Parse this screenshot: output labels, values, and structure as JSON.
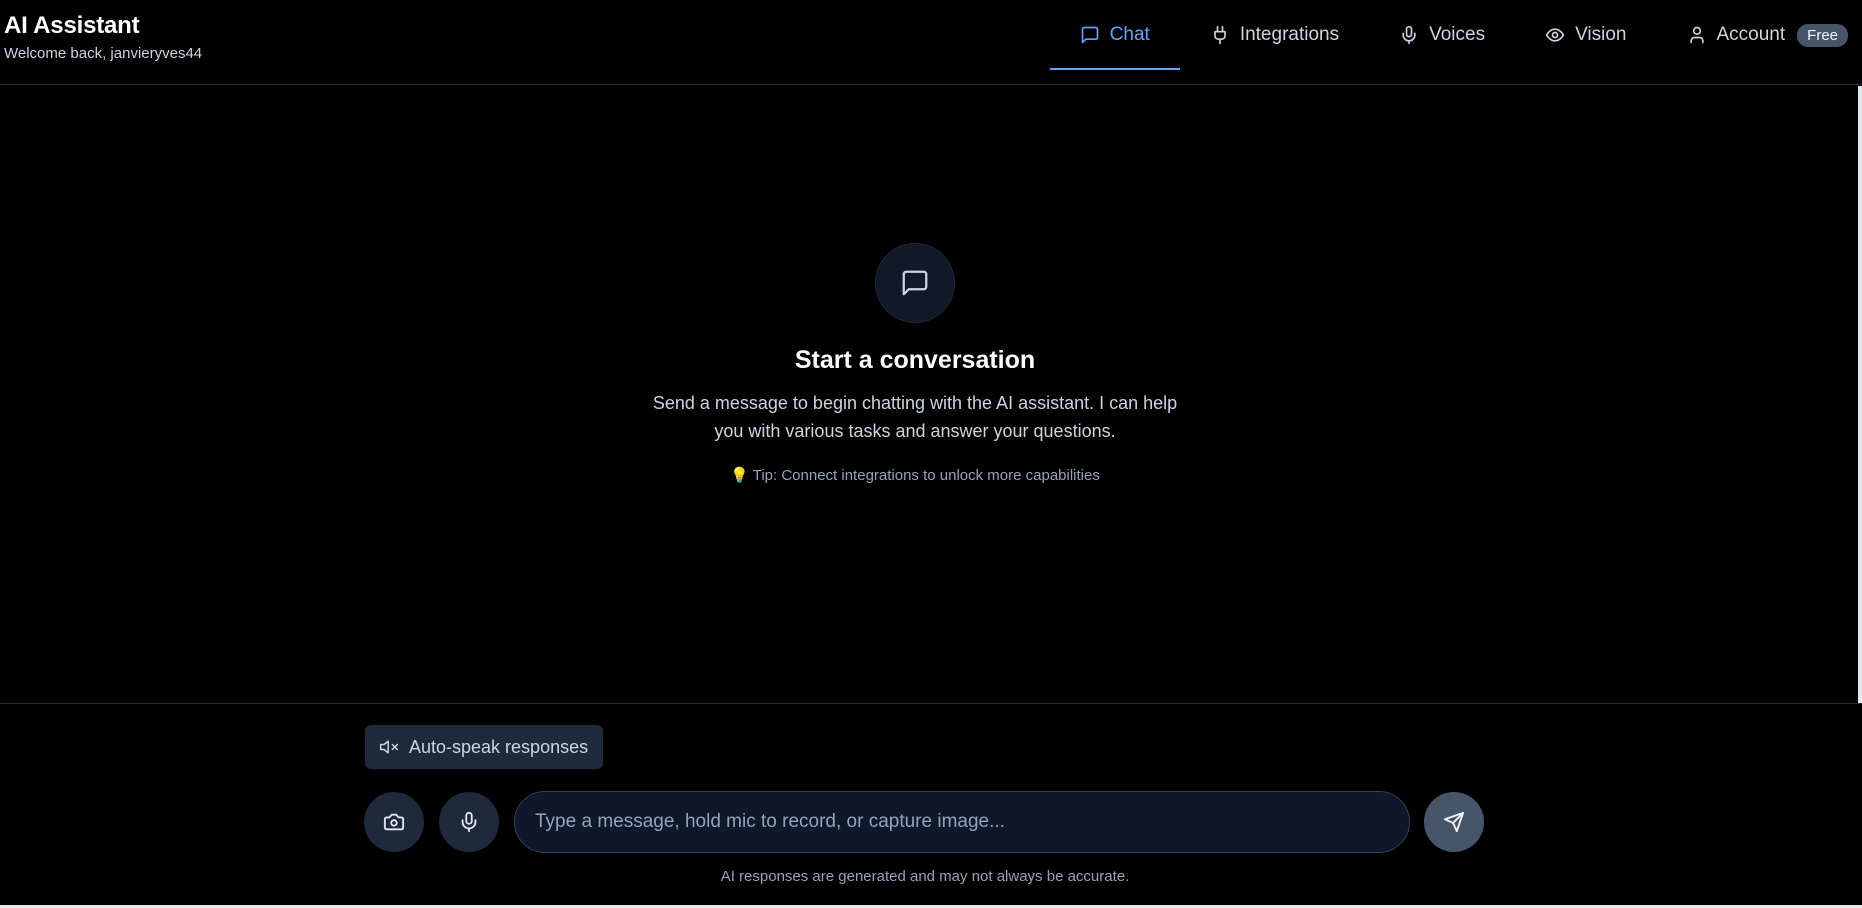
{
  "app": {
    "title": "AI Assistant",
    "welcome": "Welcome back, janvieryves44"
  },
  "nav": {
    "tabs": [
      {
        "label": "Chat",
        "icon": "message-square-icon",
        "active": true
      },
      {
        "label": "Integrations",
        "icon": "plug-icon",
        "active": false
      },
      {
        "label": "Voices",
        "icon": "mic-icon",
        "active": false
      },
      {
        "label": "Vision",
        "icon": "eye-icon",
        "active": false
      },
      {
        "label": "Account",
        "icon": "user-icon",
        "active": false
      }
    ],
    "account_badge": "Free"
  },
  "empty_state": {
    "icon": "message-square-icon",
    "title": "Start a conversation",
    "description": "Send a message to begin chatting with the AI assistant. I can help you with various tasks and answer your questions.",
    "tip_icon": "lightbulb-icon",
    "tip": "Tip: Connect integrations to unlock more capabilities"
  },
  "composer": {
    "autospeak_label": "Auto-speak responses",
    "autospeak_icon": "volume-x-icon",
    "camera_icon": "camera-icon",
    "mic_icon": "mic-icon",
    "send_icon": "send-icon",
    "input_placeholder": "Type a message, hold mic to record, or capture image...",
    "input_value": "",
    "disclaimer": "AI responses are generated and may not always be accurate."
  },
  "colors": {
    "background": "#000000",
    "accent": "#60a5fa",
    "surface": "#1e293b",
    "muted_text": "#94a3b8"
  }
}
